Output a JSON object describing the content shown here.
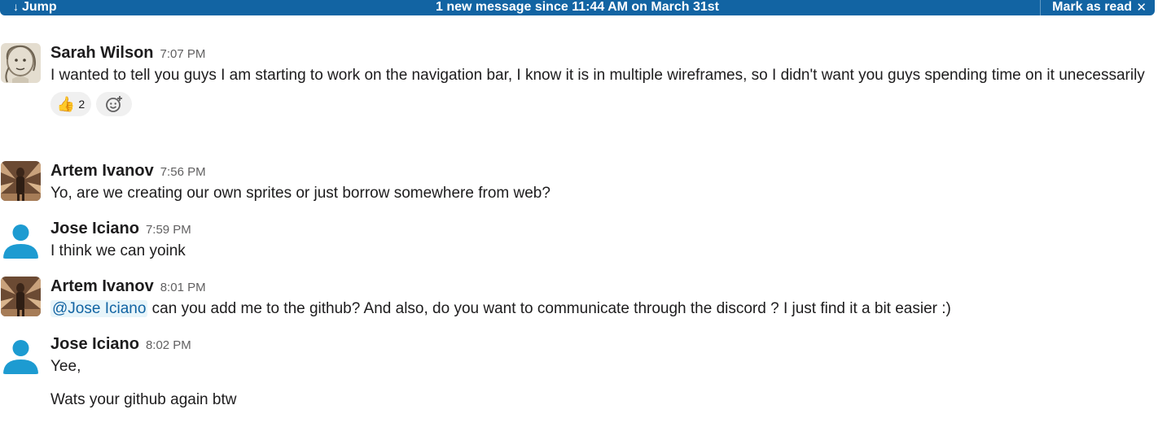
{
  "banner": {
    "jump_label": "Jump",
    "jump_icon": "arrow-down-icon",
    "new_message_text": "1 new message since 11:44 AM on March 31st",
    "mark_read_label": "Mark as read",
    "close_icon": "close-icon",
    "color": "#1264a3"
  },
  "messages": [
    {
      "author": "Sarah Wilson",
      "time": "7:07 PM",
      "avatar": "sketch-portrait-avatar",
      "lines": [
        "I wanted to tell you guys I am starting to work on the navigation bar, I know it is in multiple wireframes, so I didn't want you guys spending time on it unecessarily"
      ],
      "reactions": [
        {
          "emoji": "👍",
          "icon": "thumbs-up-emoji",
          "count": "2"
        },
        {
          "icon": "add-reaction-icon"
        }
      ]
    },
    {
      "author": "Artem Ivanov",
      "time": "7:56 PM",
      "avatar": "photo-avatar",
      "lines": [
        "Yo, are we creating our own sprites or just borrow somewhere from web?"
      ]
    },
    {
      "author": "Jose Iciano",
      "time": "7:59 PM",
      "avatar": "default-user-avatar",
      "lines": [
        "I think we can yoink"
      ]
    },
    {
      "author": "Artem Ivanov",
      "time": "8:01 PM",
      "avatar": "photo-avatar",
      "mention": "@Jose Iciano",
      "lines": [
        " can you add me to the github? And also, do you want to communicate through the discord ? I just find it a bit easier :)"
      ]
    },
    {
      "author": "Jose Iciano",
      "time": "8:02 PM",
      "avatar": "default-user-avatar",
      "lines": [
        "Yee,",
        "Wats your github again btw"
      ]
    }
  ],
  "colors": {
    "mention_bg": "#e8f5fa",
    "mention_text": "#1264a3",
    "default_avatar": "#1d9bd1"
  }
}
